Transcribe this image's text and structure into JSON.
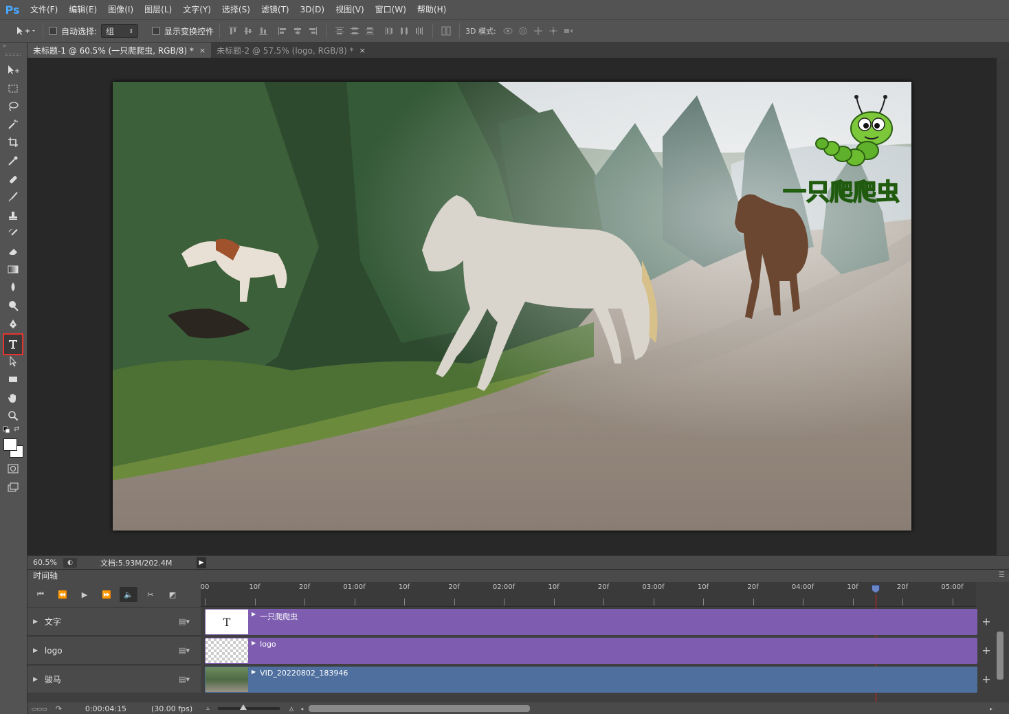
{
  "app": {
    "logo": "Ps"
  },
  "menu": [
    "文件(F)",
    "编辑(E)",
    "图像(I)",
    "图层(L)",
    "文字(Y)",
    "选择(S)",
    "滤镜(T)",
    "3D(D)",
    "视图(V)",
    "窗口(W)",
    "帮助(H)"
  ],
  "options": {
    "auto_select_label": "自动选择:",
    "auto_select_value": "组",
    "show_transform_label": "显示变换控件",
    "mode_3d_label": "3D 模式:"
  },
  "tabs": [
    {
      "label": "未标题-1 @ 60.5% (一只爬爬虫, RGB/8) *",
      "close": "×"
    },
    {
      "label": "未标题-2 @ 57.5% (logo, RGB/8) *",
      "close": "×"
    }
  ],
  "tools": [
    "move-tool-icon",
    "marquee-tool-icon",
    "lasso-tool-icon",
    "magic-wand-icon",
    "crop-tool-icon",
    "eyedropper-icon",
    "healing-brush-icon",
    "brush-tool-icon",
    "clone-stamp-icon",
    "history-brush-icon",
    "eraser-icon",
    "gradient-icon",
    "blur-icon",
    "dodge-icon",
    "pen-tool-icon",
    "type-tool-icon",
    "path-select-icon",
    "rectangle-tool-icon",
    "hand-tool-icon",
    "zoom-tool-icon"
  ],
  "logo_text": "一只爬爬虫",
  "status": {
    "zoom": "60.5%",
    "doc_info": "文档:5.93M/202.4M"
  },
  "timeline": {
    "title": "时间轴",
    "ruler": [
      "00",
      "10f",
      "20f",
      "01:00f",
      "10f",
      "20f",
      "02:00f",
      "10f",
      "20f",
      "03:00f",
      "10f",
      "20f",
      "04:00f",
      "10f",
      "20f",
      "05:00f"
    ],
    "tracks": [
      {
        "name": "文字",
        "clip": "一只爬爬虫",
        "color": "#7e5db0"
      },
      {
        "name": "logo",
        "clip": "logo",
        "color": "#7e5db0"
      },
      {
        "name": "骏马",
        "clip": "VID_20220802_183946",
        "color": "#4f6f9e"
      }
    ],
    "timecode": "0:00:04:15",
    "fps": "(30.00 fps)",
    "playhead_seconds": 4.5
  },
  "colors": {
    "accent_red": "#e3342f",
    "ui_bg": "#535353",
    "canvas_bg": "#282828"
  }
}
